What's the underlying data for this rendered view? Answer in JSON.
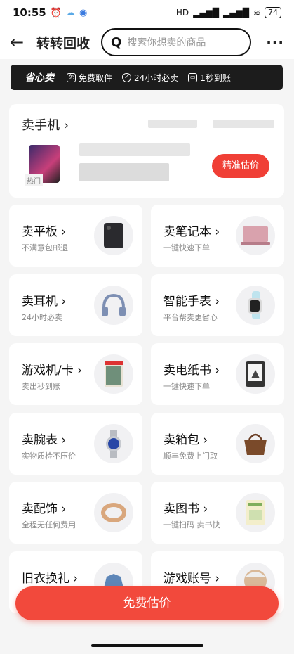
{
  "status": {
    "time": "10:55",
    "battery": "74",
    "network": "HD"
  },
  "header": {
    "title": "转转回收",
    "search_placeholder": "搜索你想卖的商品",
    "more": "···"
  },
  "banner": {
    "title": "省心卖",
    "features": [
      "免费取件",
      "24小时必卖",
      "1秒到账"
    ]
  },
  "phone": {
    "title": "卖手机 ›",
    "hot_tag": "热门",
    "estimate_label": "精准估价"
  },
  "categories": [
    {
      "name": "卖平板 ›",
      "sub": "不满意包邮退",
      "icon": "tablet-icon"
    },
    {
      "name": "卖笔记本 ›",
      "sub": "一键快速下单",
      "icon": "laptop-icon"
    },
    {
      "name": "卖耳机 ›",
      "sub": "24小时必卖",
      "icon": "headphones-icon"
    },
    {
      "name": "智能手表 ›",
      "sub": "平台帮卖更省心",
      "icon": "smartwatch-icon"
    },
    {
      "name": "游戏机/卡 ›",
      "sub": "卖出秒到账",
      "icon": "game-card-icon"
    },
    {
      "name": "卖电纸书 ›",
      "sub": "一键快速下单",
      "icon": "ereader-icon"
    },
    {
      "name": "卖腕表 ›",
      "sub": "实物质检不压价",
      "icon": "wristwatch-icon"
    },
    {
      "name": "卖箱包 ›",
      "sub": "顺丰免费上门取",
      "icon": "handbag-icon"
    },
    {
      "name": "卖配饰 ›",
      "sub": "全程无任何费用",
      "icon": "ring-icon"
    },
    {
      "name": "卖图书 ›",
      "sub": "一键扫码 卖书快",
      "icon": "book-icon"
    },
    {
      "name": "旧衣换礼 ›",
      "sub": "",
      "icon": "jacket-icon"
    },
    {
      "name": "游戏账号 ›",
      "sub": "",
      "icon": "game-character-icon"
    }
  ],
  "cta_label": "免费估价",
  "colors": {
    "accent": "#f2493c",
    "banner_bg": "#1c1c1c"
  }
}
